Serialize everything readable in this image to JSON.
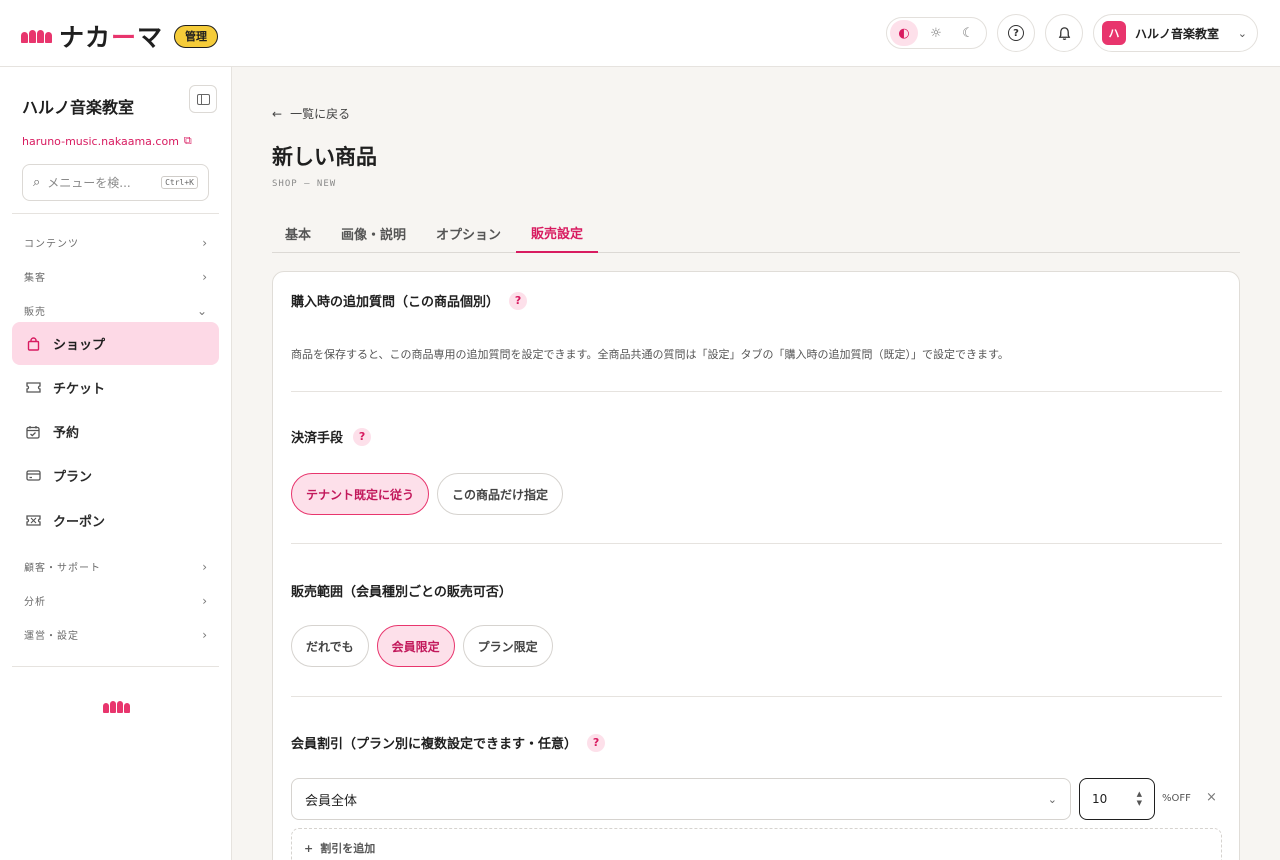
{
  "header": {
    "logo_prefix": "ナカ",
    "logo_accent": "ー",
    "logo_suffix": "マ",
    "admin_badge": "管理",
    "theme_options": [
      "contrast-icon",
      "sun-icon",
      "moon-icon"
    ],
    "tenant_avatar": "ハ",
    "tenant_name": "ハルノ音楽教室"
  },
  "sidebar": {
    "title": "ハルノ音楽教室",
    "url": "haruno-music.nakaama.com",
    "search_placeholder": "メニューを検...",
    "search_shortcut": "Ctrl+K",
    "groups": {
      "content": "コンテンツ",
      "marketing": "集客",
      "sales": "販売",
      "customers": "顧客・サポート",
      "analytics": "分析",
      "operations": "運営・設定"
    },
    "items": [
      {
        "label": "ショップ",
        "icon": "shopping-bag-icon"
      },
      {
        "label": "チケット",
        "icon": "ticket-icon"
      },
      {
        "label": "予約",
        "icon": "calendar-icon"
      },
      {
        "label": "プラン",
        "icon": "card-icon"
      },
      {
        "label": "クーポン",
        "icon": "coupon-icon"
      }
    ]
  },
  "main": {
    "back_label": "一覧に戻る",
    "title": "新しい商品",
    "subtitle": "SHOP — NEW",
    "tabs": [
      "基本",
      "画像・説明",
      "オプション",
      "販売設定"
    ],
    "active_tab": "販売設定",
    "sections": {
      "extra_questions": {
        "title": "購入時の追加質問（この商品個別）",
        "description": "商品を保存すると、この商品専用の追加質問を設定できます。全商品共通の質問は「設定」タブの「購入時の追加質問（既定）」で設定できます。"
      },
      "payment": {
        "title": "決済手段",
        "options": [
          "テナント既定に従う",
          "この商品だけ指定"
        ],
        "selected": "テナント既定に従う"
      },
      "sales_scope": {
        "title": "販売範囲（会員種別ごとの販売可否）",
        "options": [
          "だれでも",
          "会員限定",
          "プラン限定"
        ],
        "selected": "会員限定"
      },
      "member_discount": {
        "title": "会員割引（プラン別に複数設定できます・任意）",
        "target_value": "会員全体",
        "discount_value": "10",
        "unit": "%OFF",
        "add_label": "割引を追加"
      }
    }
  },
  "colors": {
    "accent": "#e8356d",
    "accent_dark": "#d81b60",
    "accent_light": "#fde0ea",
    "badge_yellow": "#f5cc3a"
  }
}
